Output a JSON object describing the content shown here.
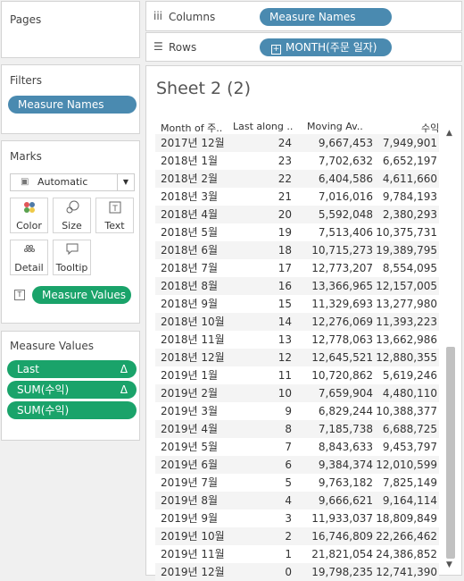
{
  "left": {
    "pages_title": "Pages",
    "filters_title": "Filters",
    "filter_pill": "Measure Names",
    "marks_title": "Marks",
    "mark_type": "Automatic",
    "mark_buttons": [
      "Color",
      "Size",
      "Text",
      "Detail",
      "Tooltip"
    ],
    "text_pill": "Measure Values",
    "measure_values_title": "Measure Values",
    "measure_pills": [
      {
        "label": "Last",
        "delta": "Δ"
      },
      {
        "label": "SUM(수익)",
        "delta": "Δ"
      },
      {
        "label": "SUM(수익)",
        "delta": ""
      }
    ]
  },
  "shelves": {
    "columns_label": "Columns",
    "columns_pill": "Measure Names",
    "rows_label": "Rows",
    "rows_pill": "MONTH(주문 일자)"
  },
  "sheet": {
    "title": "Sheet 2 (2)",
    "headers": [
      "Month of 주..",
      "Last along ..",
      "Moving Av..",
      "수익"
    ],
    "rows": [
      [
        "2017년 12월",
        "24",
        "9,667,453",
        "7,949,901"
      ],
      [
        "2018년 1월",
        "23",
        "7,702,632",
        "6,652,197"
      ],
      [
        "2018년 2월",
        "22",
        "6,404,586",
        "4,611,660"
      ],
      [
        "2018년 3월",
        "21",
        "7,016,016",
        "9,784,193"
      ],
      [
        "2018년 4월",
        "20",
        "5,592,048",
        "2,380,293"
      ],
      [
        "2018년 5월",
        "19",
        "7,513,406",
        "10,375,731"
      ],
      [
        "2018년 6월",
        "18",
        "10,715,273",
        "19,389,795"
      ],
      [
        "2018년 7월",
        "17",
        "12,773,207",
        "8,554,095"
      ],
      [
        "2018년 8월",
        "16",
        "13,366,965",
        "12,157,005"
      ],
      [
        "2018년 9월",
        "15",
        "11,329,693",
        "13,277,980"
      ],
      [
        "2018년 10월",
        "14",
        "12,276,069",
        "11,393,223"
      ],
      [
        "2018년 11월",
        "13",
        "12,778,063",
        "13,662,986"
      ],
      [
        "2018년 12월",
        "12",
        "12,645,521",
        "12,880,355"
      ],
      [
        "2019년 1월",
        "11",
        "10,720,862",
        "5,619,246"
      ],
      [
        "2019년 2월",
        "10",
        "7,659,904",
        "4,480,110"
      ],
      [
        "2019년 3월",
        "9",
        "6,829,244",
        "10,388,377"
      ],
      [
        "2019년 4월",
        "8",
        "7,185,738",
        "6,688,725"
      ],
      [
        "2019년 5월",
        "7",
        "8,843,633",
        "9,453,797"
      ],
      [
        "2019년 6월",
        "6",
        "9,384,374",
        "12,010,599"
      ],
      [
        "2019년 7월",
        "5",
        "9,763,182",
        "7,825,149"
      ],
      [
        "2019년 8월",
        "4",
        "9,666,621",
        "9,164,114"
      ],
      [
        "2019년 9월",
        "3",
        "11,933,037",
        "18,809,849"
      ],
      [
        "2019년 10월",
        "2",
        "16,746,809",
        "22,266,462"
      ],
      [
        "2019년 11월",
        "1",
        "21,821,054",
        "24,386,852"
      ],
      [
        "2019년 12월",
        "0",
        "19,798,235",
        "12,741,390"
      ]
    ]
  }
}
